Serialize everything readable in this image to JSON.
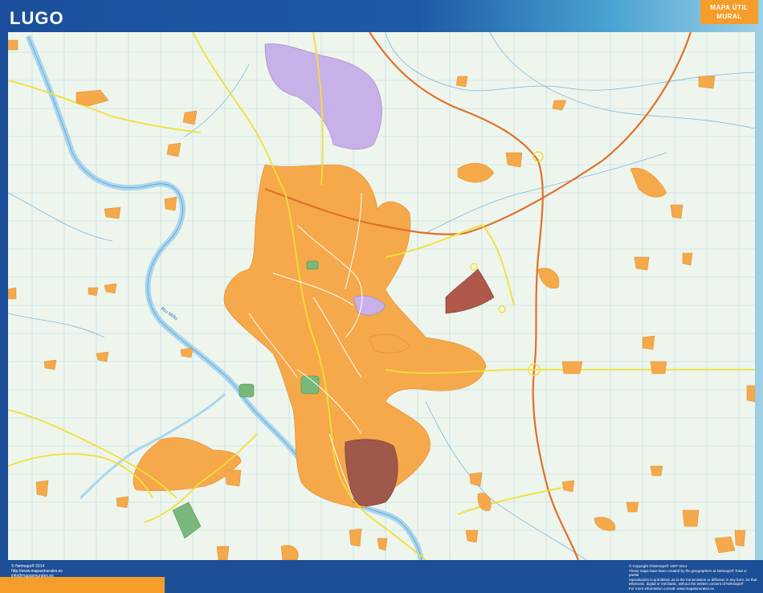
{
  "map": {
    "title": "LUGO",
    "river_label": "Río Miño"
  },
  "brand": {
    "line1": "MAPA ÚTIL",
    "line2": "MURAL"
  },
  "footer": {
    "left_lines": [
      "© Netmaps® 2014",
      "http://www.mapasmurales.es",
      "info@mapasmurales.es"
    ],
    "right_lines": [
      "© Copyright ©Netmaps® 1997-2014",
      "These maps have been created by the geographers at Netmaps® Total or partial",
      "reproduction is prohibited, as is the transmission or diffusion in any form, be that",
      "electronic, digital or mechanic, without the written consent of Netmaps®",
      "For more information consult: www.mapasmurales.es"
    ]
  },
  "colors": {
    "background": "#eef5ec",
    "urban": "#f5a94a",
    "river": "#a9d6f0",
    "road_major": "#f0e038",
    "motorway": "#e0702a",
    "industrial": "#c8b0e8",
    "historic": "#a0584a",
    "park": "#78b87a",
    "frame": "#1d5aa6",
    "accent": "#f59d2a"
  }
}
